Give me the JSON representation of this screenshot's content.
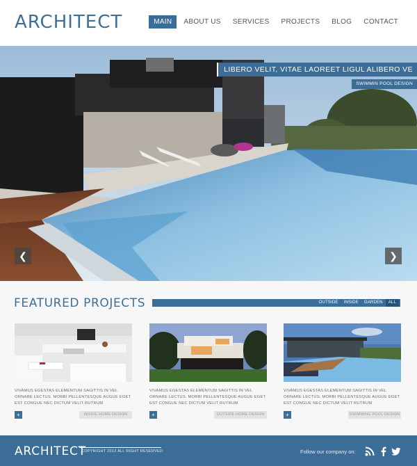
{
  "header": {
    "logo": "ARCHITECT",
    "nav": [
      "MAIN",
      "ABOUT US",
      "SERVICES",
      "PROJECTS",
      "BLOG",
      "CONTACT"
    ]
  },
  "hero": {
    "caption_title": "LIBERO VELIT, VITAE LAOREET LIGUL ALIBERO VE",
    "caption_sub": "SWIMMIN POOL DESIGN",
    "prev_glyph": "❮",
    "next_glyph": "❯"
  },
  "featured": {
    "title": "FEATURED PROJECTS",
    "filters": [
      "OUTSIDE",
      "INSIDE",
      "GARDEN",
      "ALL"
    ],
    "cards": [
      {
        "desc": "VIVAMUS EGESTAS ELEMENTUM SAGITTIS IN VEL ORNARE LECTUS. MORBI PELLENTESQUE AUGUE EGET EST CONGUE NEC DICTUM VELIT RUTRUM",
        "tag": "INSIDE HOME DESIGN",
        "plus": "+"
      },
      {
        "desc": "VIVAMUS EGESTAS ELEMENTUM SAGITTIS IN VEL ORNARE LECTUS. MORBI PELLENTESQUE AUGUE EGET EST CONGUE NEC DICTUM VELIT RUTRUM",
        "tag": "OUTSIDE HOME DESIGN",
        "plus": "+"
      },
      {
        "desc": "VIVAMUS EGESTAS ELEMENTUM SAGITTIS IN VEL ORNARE LECTUS. MORBI PELLENTESQUE AUGUE EGET EST CONGUE NEC DICTUM VELIT RUTRUM",
        "tag": "SWIMMING POOL DESIGN",
        "plus": "+"
      }
    ]
  },
  "footer": {
    "logo": "ARCHITECT",
    "copyright": "COPYRIGHT 2012 ALL RIGHT RESERVED",
    "follow": "Follow our company on:",
    "social": [
      "rss-icon",
      "facebook-icon",
      "twitter-icon"
    ]
  },
  "colors": {
    "accent": "#3a6e98",
    "logo": "#3e6f97"
  }
}
